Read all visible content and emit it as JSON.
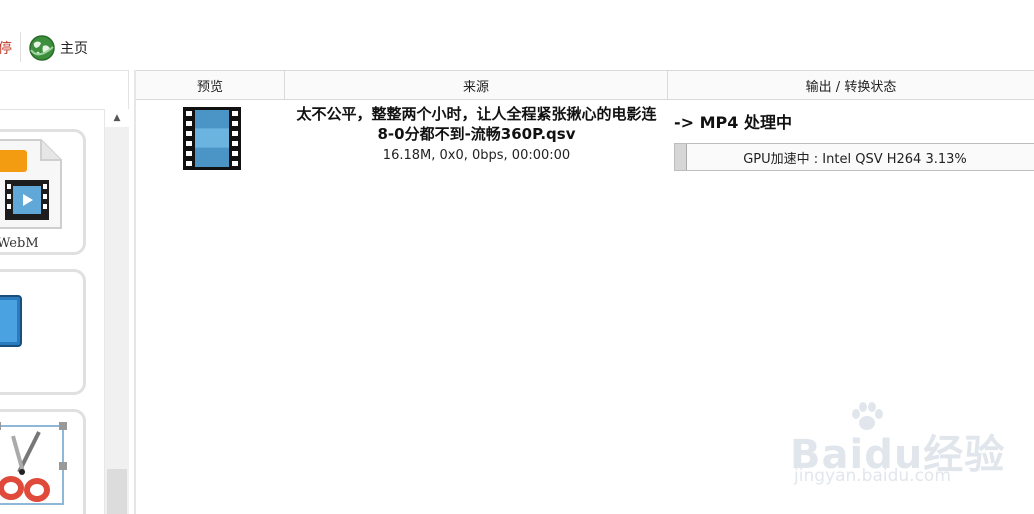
{
  "toolbar": {
    "partial_label": "停",
    "home_label": "主页",
    "home_icon": "globe-icon"
  },
  "left": {
    "cards": [
      {
        "label": "WebM",
        "icon": "webm-file-icon"
      },
      {
        "label": "",
        "icon": "screen-icon"
      },
      {
        "label": "",
        "icon": "scissors-icon"
      }
    ],
    "scroll_up_glyph": "▲"
  },
  "table": {
    "headers": {
      "preview": "预览",
      "source": "来源",
      "output": "输出 / 转换状态"
    },
    "rows": [
      {
        "thumbnail_icon": "film-icon",
        "source_title": "太不公平，整整两个小时，让人全程紧张揪心的电影连8-0分都不到-流畅360P.qsv",
        "source_meta": "16.18M, 0x0, 0bps, 00:00:00",
        "output_status": "-> MP4 处理中",
        "progress_text": "GPU加速中 : Intel QSV H264 3.13%",
        "progress_percent": 3.13
      }
    ]
  },
  "watermark": {
    "brand": "Baidu经验",
    "url": "jingyan.baidu.com"
  },
  "colors": {
    "accent_red": "#c0392b",
    "film_blue": "#5fa8d8",
    "border": "#d9d9d9"
  }
}
